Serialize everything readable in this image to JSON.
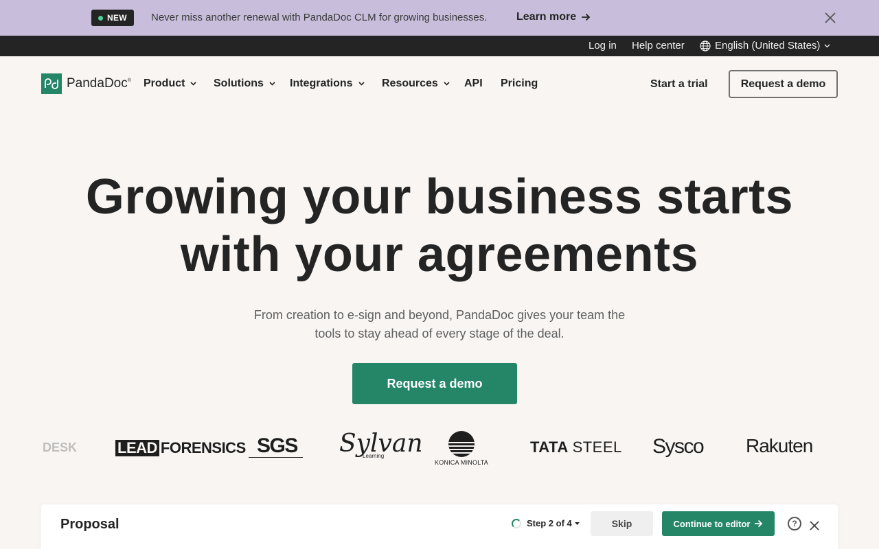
{
  "announcement": {
    "badge": "NEW",
    "message": "Never miss another renewal with PandaDoc CLM for growing businesses.",
    "link": "Learn more"
  },
  "utility": {
    "login": "Log in",
    "help": "Help center",
    "language": "English (United States)"
  },
  "nav": {
    "brand": "PandaDoc",
    "items": [
      {
        "label": "Product"
      },
      {
        "label": "Solutions"
      },
      {
        "label": "Integrations"
      },
      {
        "label": "Resources"
      },
      {
        "label": "API"
      },
      {
        "label": "Pricing"
      }
    ],
    "trial": "Start a trial",
    "demo": "Request a demo"
  },
  "hero": {
    "title_line1": "Growing your business starts",
    "title_line2": "with your agreements",
    "subtitle_line1": "From creation to e-sign and beyond, PandaDoc gives your team the",
    "subtitle_line2": "tools to stay ahead of every stage of the deal.",
    "cta": "Request a demo"
  },
  "logos": {
    "desk": "DESK",
    "lead_box": "LEAD",
    "lead_rest": "FORENSICS",
    "sgs": "SGS",
    "sylvan": "Sylvan",
    "sylvan_sub": "Learning",
    "konica": "KONICA MINOLTA",
    "tata": "TATA",
    "tata_rest": "STEEL",
    "sysco": "Sysco",
    "rakuten": "Rakuten"
  },
  "panel": {
    "title": "Proposal",
    "step": "Step 2 of 4",
    "skip": "Skip",
    "continue": "Continue to editor",
    "help": "?"
  },
  "colors": {
    "brand_green": "#248567",
    "announcement_bg": "#c8bedc",
    "utility_bg": "#242424",
    "page_bg": "#f8f5f3"
  }
}
